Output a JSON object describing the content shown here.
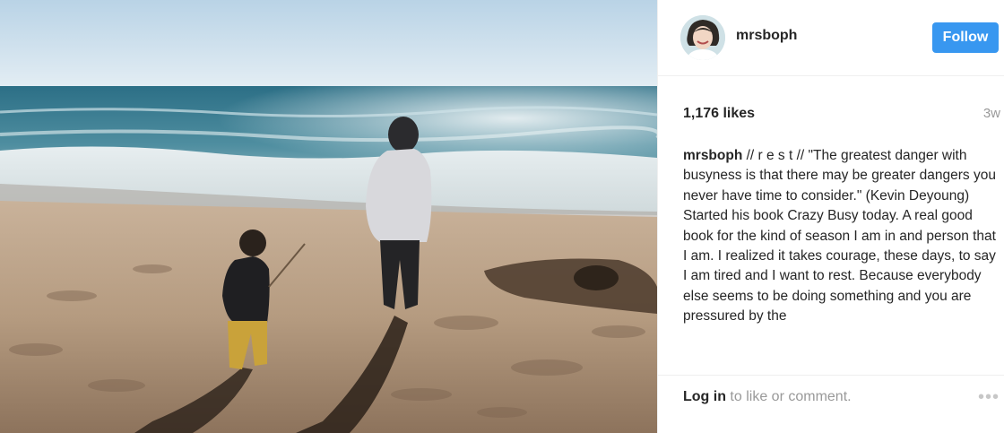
{
  "post": {
    "image_alt": "Two children standing on a sandy beach facing the ocean",
    "username": "mrsboph",
    "follow_label": "Follow",
    "likes": "1,176 likes",
    "time_ago": "3w",
    "caption_username": "mrsboph",
    "caption_text": " // r e s t // \"The greatest danger with busyness is that there may be greater dangers you never have time to consider.\" (Kevin Deyoung) Started his book Crazy Busy today. A real good book for the kind of season I am in and person that I am. I realized it takes courage, these days, to say I am tired and I want to rest. Because everybody else seems to be doing something and you are pressured by the",
    "login_link": "Log in",
    "login_rest": " to like or comment.",
    "more_label": "•••"
  },
  "colors": {
    "follow_button": "#3897f0",
    "muted_text": "#999999",
    "primary_text": "#262626"
  }
}
